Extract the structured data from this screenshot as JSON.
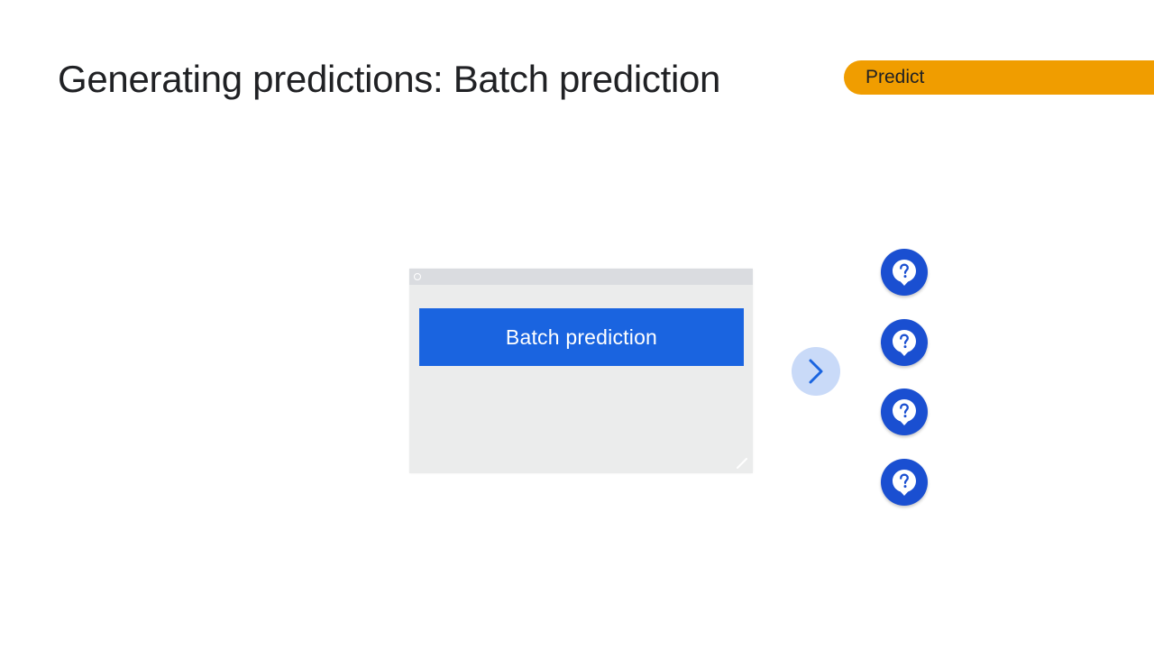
{
  "slide": {
    "title": "Generating predictions: Batch prediction",
    "stage_tag": "Predict"
  },
  "window": {
    "button_label": "Batch prediction"
  },
  "icons": {
    "window_control": "circle-icon",
    "resize": "resize-handle-icon",
    "arrow": "chevron-right-icon",
    "prediction": "help-bubble-icon"
  },
  "predictions": {
    "count": 4
  },
  "colors": {
    "tag": "#f09d00",
    "button": "#1a64e0",
    "window": "#ebecec",
    "titlebar": "#dadce0",
    "arrow_bg": "#c9daf8",
    "arrow_fg": "#1a64e0",
    "prediction_icon": "#1a4fd1"
  }
}
